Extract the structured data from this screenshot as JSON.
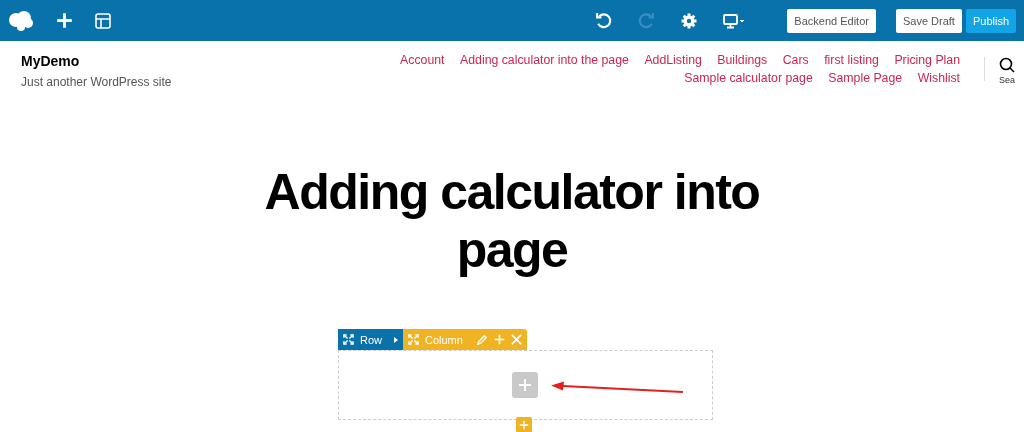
{
  "toolbar": {
    "buttons": [
      "Backend Editor",
      "Save Draft",
      "Publish"
    ],
    "redo_disabled": true
  },
  "site": {
    "title": "MyDemo",
    "tagline": "Just another WordPress site"
  },
  "nav": {
    "items": [
      "Account",
      "Adding calculator into the page",
      "AddListing",
      "Buildings",
      "Cars",
      "first listing",
      "Pricing Plan",
      "Sample calculator page",
      "Sample Page",
      "Wishlist"
    ]
  },
  "search": {
    "label": "Sea"
  },
  "page_title": "Adding calculator into page",
  "row_controls": {
    "row_label": "Row",
    "column_label": "Column"
  }
}
